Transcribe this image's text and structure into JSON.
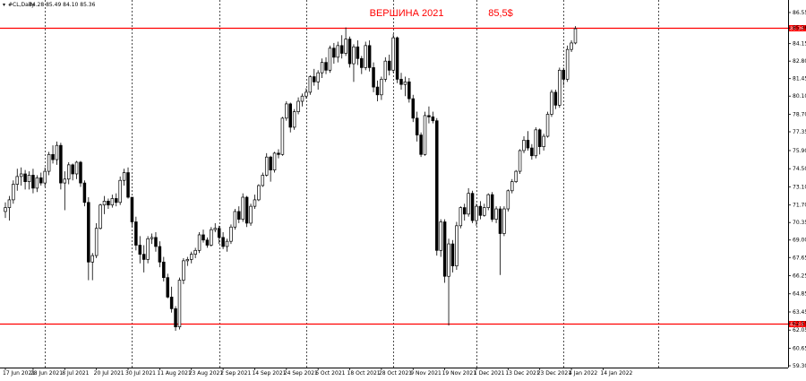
{
  "header": {
    "symbol": "#CL,Daily",
    "ohlc": "84.28 85.49 84.10 85.36"
  },
  "colors": {
    "bull": "#ffffff",
    "bear": "#000000",
    "candle_outline": "#000000",
    "level_line": "#ff0000",
    "annotation": "#ff0000",
    "grid": "#000000",
    "axis": "#000000",
    "background": "#ffffff"
  },
  "chart_data": {
    "type": "candlestick",
    "timeframe": "Daily",
    "ylim": [
      59.3,
      87.1
    ],
    "y_ticks": [
      {
        "v": 86.55,
        "label": "86.55"
      },
      {
        "v": 85.36,
        "label": "85.36"
      },
      {
        "v": 84.15,
        "label": "84.15"
      },
      {
        "v": 82.8,
        "label": "82.80"
      },
      {
        "v": 81.45,
        "label": "81.45"
      },
      {
        "v": 80.1,
        "label": "80.10"
      },
      {
        "v": 78.7,
        "label": "78.70"
      },
      {
        "v": 77.35,
        "label": "77.35"
      },
      {
        "v": 75.9,
        "label": "75.90"
      },
      {
        "v": 74.5,
        "label": "74.50"
      },
      {
        "v": 73.1,
        "label": "73.10"
      },
      {
        "v": 71.7,
        "label": "71.70"
      },
      {
        "v": 70.35,
        "label": "70.35"
      },
      {
        "v": 69.0,
        "label": "69.00"
      },
      {
        "v": 67.65,
        "label": "67.65"
      },
      {
        "v": 66.25,
        "label": "66.25"
      },
      {
        "v": 64.85,
        "label": "64.85"
      },
      {
        "v": 63.45,
        "label": "63.45"
      },
      {
        "v": 62.55,
        "label": "62.55"
      },
      {
        "v": 62.05,
        "label": "62.05"
      },
      {
        "v": 60.65,
        "label": "60.65"
      },
      {
        "v": 59.3,
        "label": "59.30"
      }
    ],
    "x_labels": [
      {
        "i": 0,
        "label": "17 Jun 2021"
      },
      {
        "i": 7,
        "label": "28 Jun 2021"
      },
      {
        "i": 15,
        "label": "8 Jul 2021"
      },
      {
        "i": 23,
        "label": "20 Jul 2021"
      },
      {
        "i": 31,
        "label": "30 Jul 2021"
      },
      {
        "i": 39,
        "label": "11 Aug 2021"
      },
      {
        "i": 47,
        "label": "23 Aug 2021"
      },
      {
        "i": 55,
        "label": "2 Sep 2021"
      },
      {
        "i": 63,
        "label": "14 Sep 2021"
      },
      {
        "i": 71,
        "label": "24 Sep 2021"
      },
      {
        "i": 79,
        "label": "6 Oct 2021"
      },
      {
        "i": 87,
        "label": "18 Oct 2021"
      },
      {
        "i": 95,
        "label": "28 Oct 2021"
      },
      {
        "i": 103,
        "label": "9 Nov 2021"
      },
      {
        "i": 111,
        "label": "19 Nov 2021"
      },
      {
        "i": 119,
        "label": "1 Dec 2021"
      },
      {
        "i": 127,
        "label": "13 Dec 2021"
      },
      {
        "i": 135,
        "label": "23 Dec 2021"
      },
      {
        "i": 143,
        "label": "4 Jan 2022"
      },
      {
        "i": 151,
        "label": "14 Jan 2022"
      }
    ],
    "separators": [
      10,
      32,
      54,
      76,
      98,
      119,
      141,
      165
    ],
    "levels": [
      {
        "value": 85.36,
        "label": "85.36"
      },
      {
        "value": 62.55,
        "label": "62.55"
      }
    ],
    "annotations": [
      {
        "text": "ВЕРШИНА 2021",
        "x_index": 92,
        "y": 86.0
      },
      {
        "text": "85,5$",
        "x_index": 122,
        "y": 86.0
      }
    ],
    "candles": [
      [
        71.2,
        71.9,
        70.7,
        71.5
      ],
      [
        71.5,
        72.4,
        70.5,
        72.1
      ],
      [
        72.1,
        73.6,
        71.8,
        73.3
      ],
      [
        73.3,
        74.5,
        72.8,
        73.9
      ],
      [
        73.9,
        74.6,
        73.2,
        74.1
      ],
      [
        74.1,
        74.4,
        72.9,
        73.5
      ],
      [
        73.5,
        74.3,
        72.9,
        74.0
      ],
      [
        74.0,
        74.5,
        72.6,
        73.0
      ],
      [
        73.0,
        74.0,
        72.7,
        73.8
      ],
      [
        73.8,
        74.2,
        73.2,
        73.4
      ],
      [
        73.4,
        74.6,
        73.1,
        74.3
      ],
      [
        74.3,
        75.8,
        74.0,
        75.6
      ],
      [
        75.6,
        76.3,
        74.9,
        75.2
      ],
      [
        75.2,
        76.6,
        74.8,
        76.3
      ],
      [
        76.3,
        76.5,
        72.9,
        73.4
      ],
      [
        73.4,
        74.3,
        71.3,
        73.7
      ],
      [
        73.7,
        75.0,
        73.3,
        74.8
      ],
      [
        74.8,
        74.9,
        73.6,
        74.1
      ],
      [
        74.1,
        75.1,
        73.7,
        75.0
      ],
      [
        75.0,
        75.1,
        73.1,
        73.4
      ],
      [
        73.4,
        73.6,
        71.6,
        71.9
      ],
      [
        71.9,
        72.3,
        65.9,
        67.3
      ],
      [
        67.3,
        68.0,
        65.9,
        67.8
      ],
      [
        67.8,
        70.3,
        67.6,
        69.9
      ],
      [
        69.9,
        71.8,
        69.8,
        71.7
      ],
      [
        71.7,
        72.4,
        71.0,
        72.0
      ],
      [
        72.0,
        72.2,
        71.4,
        71.7
      ],
      [
        71.7,
        72.5,
        71.5,
        72.2
      ],
      [
        72.2,
        72.6,
        71.6,
        71.9
      ],
      [
        71.9,
        73.9,
        71.7,
        73.6
      ],
      [
        73.6,
        74.5,
        73.2,
        74.2
      ],
      [
        74.2,
        74.6,
        72.2,
        72.3
      ],
      [
        72.3,
        72.3,
        70.0,
        70.4
      ],
      [
        70.4,
        70.8,
        68.2,
        68.6
      ],
      [
        68.6,
        69.3,
        67.2,
        67.9
      ],
      [
        67.9,
        68.6,
        66.5,
        67.5
      ],
      [
        67.5,
        69.3,
        67.2,
        69.1
      ],
      [
        69.1,
        69.5,
        68.7,
        69.2
      ],
      [
        69.2,
        69.6,
        68.1,
        68.5
      ],
      [
        68.5,
        68.9,
        66.9,
        67.3
      ],
      [
        67.3,
        67.7,
        65.8,
        66.1
      ],
      [
        66.1,
        66.4,
        64.5,
        64.6
      ],
      [
        64.6,
        65.4,
        63.4,
        63.7
      ],
      [
        63.7,
        63.9,
        62.0,
        62.3
      ],
      [
        62.3,
        66.1,
        62.1,
        65.9
      ],
      [
        65.9,
        67.6,
        65.6,
        67.4
      ],
      [
        67.4,
        67.7,
        67.0,
        67.5
      ],
      [
        67.5,
        68.1,
        67.2,
        67.9
      ],
      [
        67.9,
        68.4,
        67.6,
        68.2
      ],
      [
        68.2,
        69.6,
        68.0,
        69.4
      ],
      [
        69.4,
        69.8,
        68.8,
        69.0
      ],
      [
        69.0,
        69.2,
        68.4,
        68.6
      ],
      [
        68.6,
        70.0,
        68.5,
        69.8
      ],
      [
        69.8,
        70.3,
        69.6,
        69.9
      ],
      [
        69.9,
        70.1,
        68.7,
        69.2
      ],
      [
        69.2,
        69.6,
        68.3,
        68.5
      ],
      [
        68.5,
        69.1,
        68.1,
        68.9
      ],
      [
        68.9,
        70.2,
        68.7,
        70.0
      ],
      [
        70.0,
        71.4,
        69.8,
        71.2
      ],
      [
        71.2,
        71.6,
        70.3,
        70.6
      ],
      [
        70.6,
        72.6,
        70.4,
        72.3
      ],
      [
        72.3,
        72.4,
        70.0,
        70.3
      ],
      [
        70.3,
        71.8,
        70.1,
        71.6
      ],
      [
        71.6,
        72.5,
        71.4,
        72.1
      ],
      [
        72.1,
        73.3,
        72.0,
        73.2
      ],
      [
        73.2,
        74.2,
        73.1,
        74.0
      ],
      [
        74.0,
        75.7,
        73.9,
        75.4
      ],
      [
        75.4,
        75.5,
        73.5,
        74.4
      ],
      [
        74.4,
        75.8,
        74.2,
        75.7
      ],
      [
        75.7,
        76.0,
        75.3,
        75.6
      ],
      [
        75.6,
        78.5,
        75.5,
        78.4
      ],
      [
        78.4,
        79.7,
        78.2,
        79.5
      ],
      [
        79.5,
        79.6,
        77.3,
        77.7
      ],
      [
        77.7,
        79.1,
        77.5,
        78.9
      ],
      [
        78.9,
        80.0,
        78.7,
        79.7
      ],
      [
        79.7,
        80.3,
        79.3,
        80.1
      ],
      [
        80.1,
        80.7,
        79.9,
        80.4
      ],
      [
        80.4,
        81.7,
        80.2,
        81.6
      ],
      [
        81.6,
        82.2,
        80.9,
        81.2
      ],
      [
        81.2,
        82.1,
        80.6,
        81.9
      ],
      [
        81.9,
        83.0,
        81.5,
        82.7
      ],
      [
        82.7,
        83.1,
        81.8,
        82.1
      ],
      [
        82.1,
        84.0,
        81.9,
        83.8
      ],
      [
        83.8,
        84.2,
        82.6,
        83.1
      ],
      [
        83.1,
        84.3,
        82.7,
        84.0
      ],
      [
        84.0,
        84.8,
        83.0,
        83.4
      ],
      [
        83.4,
        85.4,
        83.2,
        84.5
      ],
      [
        84.5,
        84.7,
        82.3,
        82.6
      ],
      [
        82.6,
        84.1,
        81.2,
        83.9
      ],
      [
        83.9,
        84.4,
        82.5,
        83.0
      ],
      [
        83.0,
        83.2,
        81.8,
        82.3
      ],
      [
        82.3,
        84.3,
        82.1,
        84.0
      ],
      [
        84.0,
        84.4,
        82.0,
        82.3
      ],
      [
        82.3,
        82.7,
        80.4,
        80.8
      ],
      [
        80.8,
        81.3,
        79.7,
        80.2
      ],
      [
        80.2,
        81.6,
        79.8,
        81.4
      ],
      [
        81.4,
        83.1,
        81.2,
        82.8
      ],
      [
        82.8,
        83.3,
        81.7,
        82.1
      ],
      [
        82.1,
        84.9,
        81.9,
        84.6
      ],
      [
        84.6,
        84.7,
        81.1,
        81.4
      ],
      [
        81.4,
        81.9,
        80.6,
        81.0
      ],
      [
        81.0,
        81.6,
        80.1,
        81.2
      ],
      [
        81.2,
        81.5,
        79.6,
        79.9
      ],
      [
        79.9,
        80.2,
        78.1,
        78.4
      ],
      [
        78.4,
        78.9,
        76.6,
        77.1
      ],
      [
        77.1,
        77.3,
        75.4,
        75.6
      ],
      [
        75.6,
        78.9,
        75.5,
        78.6
      ],
      [
        78.6,
        79.3,
        78.0,
        78.5
      ],
      [
        78.5,
        78.9,
        78.0,
        78.2
      ],
      [
        78.2,
        78.4,
        67.8,
        68.2
      ],
      [
        68.2,
        70.6,
        67.7,
        70.4
      ],
      [
        70.4,
        70.6,
        65.7,
        66.2
      ],
      [
        66.2,
        69.1,
        62.4,
        68.7
      ],
      [
        68.7,
        69.0,
        66.5,
        67.0
      ],
      [
        67.0,
        70.4,
        66.7,
        70.1
      ],
      [
        70.1,
        71.6,
        69.9,
        71.5
      ],
      [
        71.5,
        71.8,
        70.5,
        71.0
      ],
      [
        71.0,
        73.0,
        70.8,
        72.6
      ],
      [
        72.6,
        72.8,
        70.3,
        70.5
      ],
      [
        70.5,
        71.8,
        70.1,
        71.6
      ],
      [
        71.6,
        72.0,
        70.6,
        70.9
      ],
      [
        70.9,
        71.8,
        70.8,
        71.5
      ],
      [
        71.5,
        72.6,
        71.3,
        72.5
      ],
      [
        72.5,
        72.7,
        70.4,
        70.6
      ],
      [
        70.6,
        71.6,
        70.3,
        71.4
      ],
      [
        71.4,
        71.6,
        66.3,
        69.5
      ],
      [
        69.5,
        71.6,
        69.3,
        71.4
      ],
      [
        71.4,
        72.9,
        71.2,
        72.8
      ],
      [
        72.8,
        73.7,
        72.6,
        73.5
      ],
      [
        73.5,
        74.4,
        73.4,
        74.3
      ],
      [
        74.3,
        76.0,
        74.1,
        75.9
      ],
      [
        75.9,
        77.0,
        75.7,
        76.7
      ],
      [
        76.7,
        77.4,
        75.9,
        76.1
      ],
      [
        76.1,
        76.4,
        75.2,
        75.5
      ],
      [
        75.5,
        77.7,
        75.3,
        77.5
      ],
      [
        77.5,
        77.6,
        75.6,
        76.2
      ],
      [
        76.2,
        77.2,
        75.9,
        77.0
      ],
      [
        77.0,
        78.9,
        76.9,
        78.7
      ],
      [
        78.7,
        80.6,
        78.5,
        80.4
      ],
      [
        80.4,
        80.6,
        79.1,
        79.4
      ],
      [
        79.4,
        82.3,
        79.2,
        82.1
      ],
      [
        82.1,
        82.3,
        80.9,
        81.4
      ],
      [
        81.4,
        84.0,
        81.2,
        83.7
      ],
      [
        83.7,
        84.4,
        83.5,
        84.2
      ],
      [
        84.2,
        85.5,
        84.1,
        85.3
      ]
    ]
  }
}
